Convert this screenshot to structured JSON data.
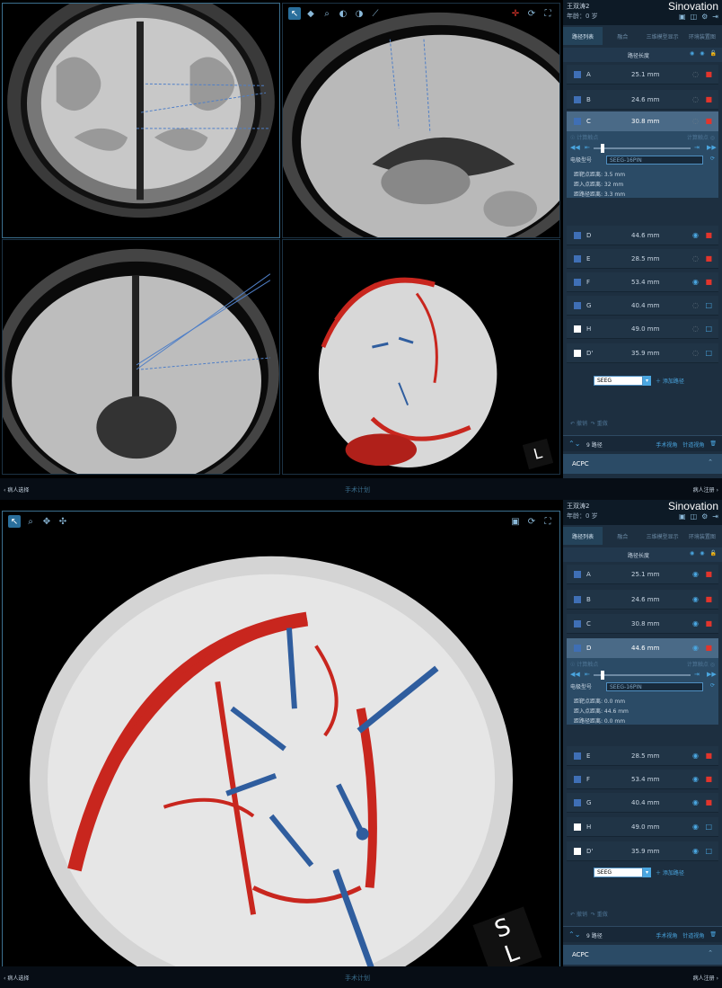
{
  "patient": {
    "name": "王双涛2",
    "age_label": "年龄：0 岁"
  },
  "brand": "Sinovation",
  "tabs": [
    "路径列表",
    "融合",
    "三维模型显示",
    "环境装置图"
  ],
  "col_header": {
    "length_label": "路径长度"
  },
  "paths": [
    {
      "name": "A",
      "length": "25.1 mm"
    },
    {
      "name": "B",
      "length": "24.6 mm"
    },
    {
      "name": "C",
      "length": "30.8 mm"
    },
    {
      "name": "D",
      "length": "44.6 mm"
    },
    {
      "name": "E",
      "length": "28.5 mm"
    },
    {
      "name": "F",
      "length": "53.4 mm"
    },
    {
      "name": "G",
      "length": "40.4 mm"
    },
    {
      "name": "H",
      "length": "49.0 mm"
    },
    {
      "name": "D'",
      "length": "35.9 mm"
    }
  ],
  "screen1": {
    "expanded": {
      "name": "C",
      "length": "30.8 mm",
      "seg_left": "☉ 计算触点",
      "seg_right": "计算触点 ◎",
      "model_label": "电极型号",
      "model_value": "SEEG-16PIN",
      "dist1": "距靶点距离: 3.5 mm",
      "dist2": "距入点距离: 32 mm",
      "dist3": "距路径距离: 3.3 mm"
    }
  },
  "screen2": {
    "expanded": {
      "name": "D",
      "length": "44.6 mm",
      "seg_left": "☉ 计算触点",
      "seg_right": "计算触点 ◎",
      "model_label": "电极型号",
      "model_value": "SEEG-16PIN",
      "dist1": "距靶点距离: 0.0 mm",
      "dist2": "距入点距离: 44.6 mm",
      "dist3": "距路径距离: 0.0 mm"
    }
  },
  "add_row": {
    "select_value": "SEEG",
    "add_label": "添加路径"
  },
  "undo": {
    "undo": "撤销",
    "redo": "重做"
  },
  "footer": {
    "count": "9 路径",
    "surgery_view": "手术视角",
    "needle_view": "针道视角",
    "acpc": "ACPC"
  },
  "bottombar": {
    "left": "病人选择",
    "center": "手术计划",
    "right": "病人注册"
  },
  "orientation": {
    "top": "S",
    "side": "L"
  },
  "colors": {
    "accent": "#4aa6e0",
    "lock_red": "#e2352c",
    "panel_bg": "#1d2f40",
    "vessel_red": "#c8261e",
    "electrode_blue": "#2f5d9e"
  }
}
